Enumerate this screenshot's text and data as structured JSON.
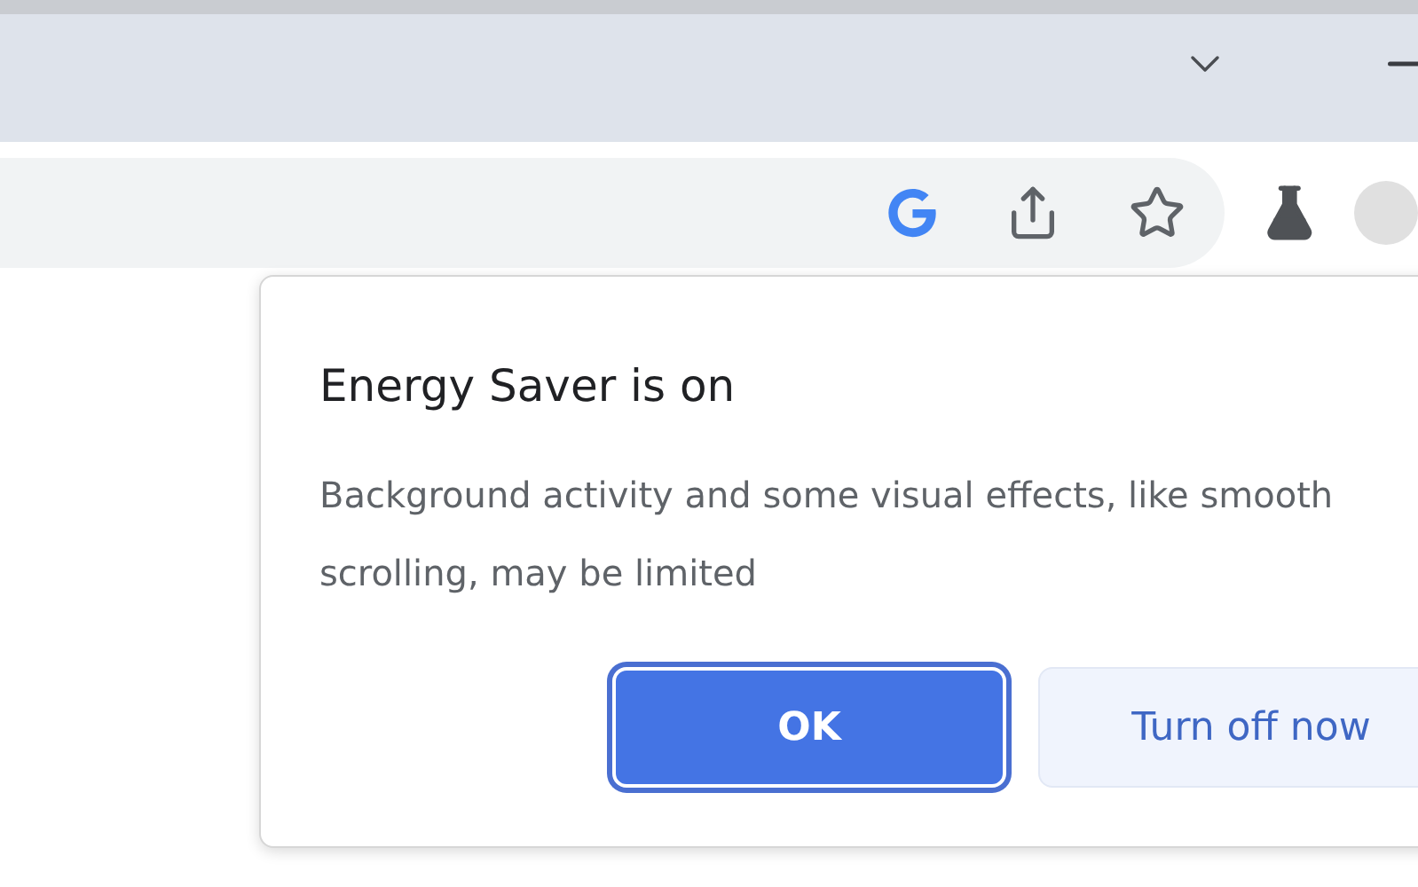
{
  "popup": {
    "title": "Energy Saver is on",
    "message": "Background activity and some visual effects, like smooth scrolling, may be limited",
    "buttons": [
      {
        "label": "OK",
        "kind": "primary",
        "focused": true
      },
      {
        "label": "Turn off now",
        "kind": "secondary",
        "focused": false
      }
    ]
  }
}
